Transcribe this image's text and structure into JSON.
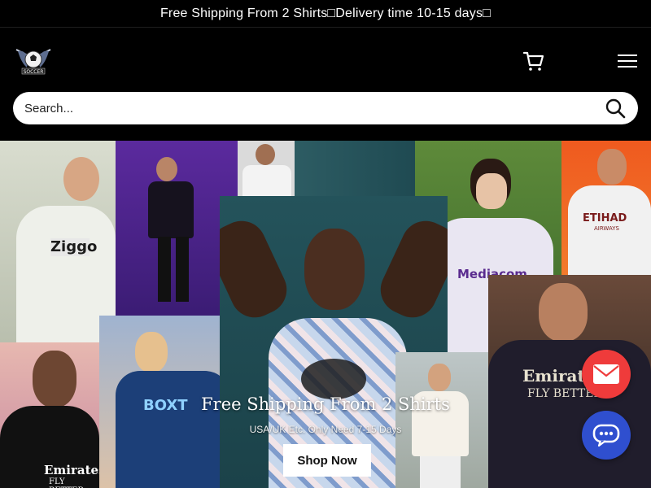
{
  "announcement": {
    "text": "Free Shipping From 2 Shirts□Delivery time 10-15 days□"
  },
  "header": {
    "logo_text": "SOCCER",
    "logo_icon": "winged-soccer-ball-logo",
    "cart_icon": "cart-icon",
    "menu_icon": "hamburger-menu-icon"
  },
  "search": {
    "placeholder": "Search...",
    "icon": "search-icon"
  },
  "hero": {
    "title": "Free Shipping From 2 Shirts",
    "subtitle": "USA/UK Etc. Only Need 7-15 Days",
    "button_label": "Shop Now",
    "jersey_texts": {
      "ziggo": "Ziggo",
      "boxt": "BOXT",
      "mediacom": "Mediacom",
      "etihad": "ETIHAD",
      "etihad_sub": "AIRWAYS",
      "emirates_left": "Emirates",
      "emirates_left_sub": "FLY BETTER",
      "emirates_right": "Emirates",
      "emirates_right_sub": "FLY BETTER"
    }
  },
  "floating": {
    "mail_icon": "mail-icon",
    "chat_icon": "chat-bubble-icon"
  },
  "colors": {
    "mail": "#ef3b3b",
    "chat": "#2f4fcf",
    "background": "#000000"
  }
}
